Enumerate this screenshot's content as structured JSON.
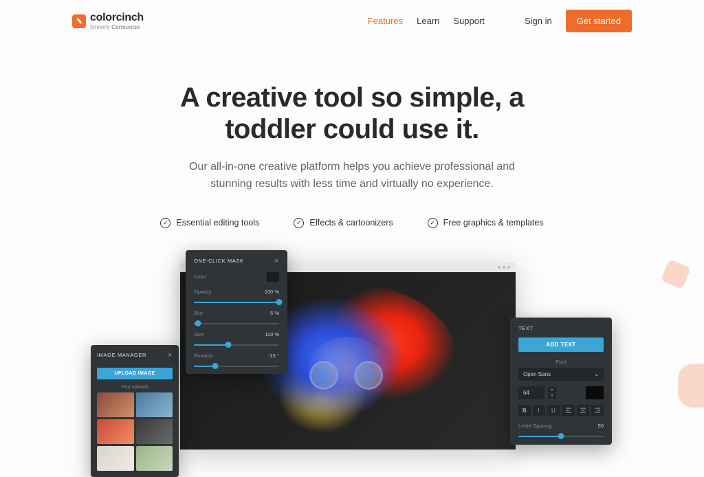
{
  "brand": {
    "name": "colorcinch",
    "tagline_prefix": "formerly ",
    "tagline_bold": "Cartoonize"
  },
  "nav": {
    "features": "Features",
    "learn": "Learn",
    "support": "Support",
    "signin": "Sign in",
    "cta": "Get started"
  },
  "hero": {
    "title_line1": "A creative tool so simple, a",
    "title_line2": "toddler could use it.",
    "subtitle_line1": "Our all-in-one creative platform helps you achieve professional and",
    "subtitle_line2": "stunning results with less time and virtually no experience."
  },
  "features": {
    "f1": "Essential editing tools",
    "f2": "Effects & cartoonizers",
    "f3": "Free graphics & templates"
  },
  "mask_panel": {
    "title": "ONE-CLICK MASK",
    "color_label": "Color",
    "opacity_label": "Opacity",
    "opacity_value": "100 %",
    "blur_label": "Blur",
    "blur_value": "5 %",
    "size_label": "Size",
    "size_value": "110 %",
    "rotation_label": "Rotation",
    "rotation_value": "-15 °"
  },
  "text_panel": {
    "title": "TEXT",
    "add_btn": "ADD TEXT",
    "font_label": "Font",
    "font_value": "Open Sans",
    "size_value": "64",
    "spacing_label": "Letter Spacing",
    "spacing_value": "50"
  },
  "img_panel": {
    "title": "IMAGE MANAGER",
    "upload_btn": "UPLOAD IMAGE",
    "section": "Your uploads"
  }
}
